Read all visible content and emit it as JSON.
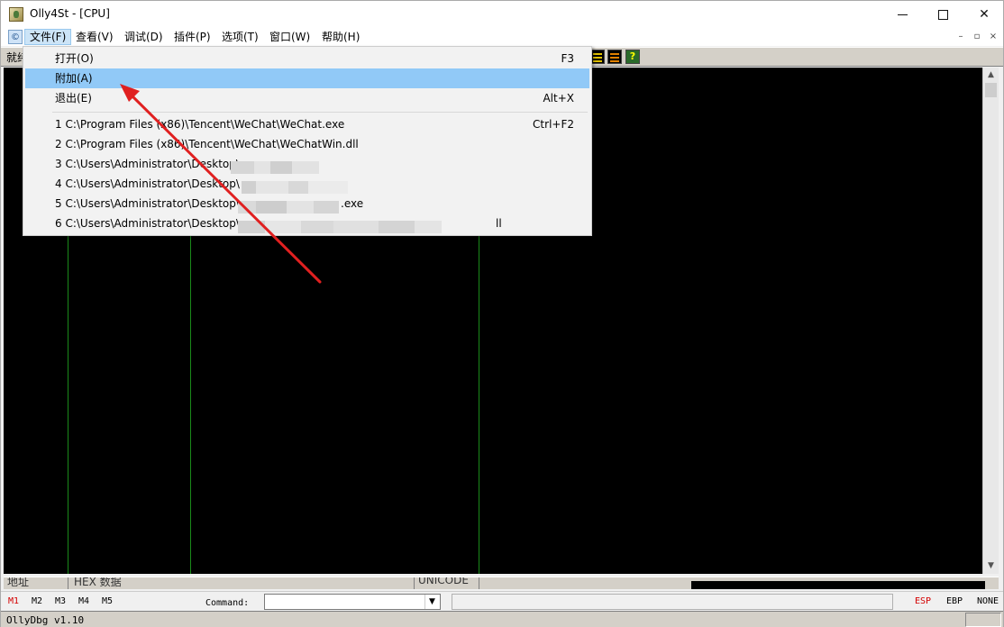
{
  "window": {
    "title": "Olly4St - [CPU]"
  },
  "menubar": {
    "items": [
      "文件(F)",
      "查看(V)",
      "调试(D)",
      "插件(P)",
      "选项(T)",
      "窗口(W)",
      "帮助(H)"
    ],
    "mdi_icon_glyph": "©",
    "mdi_controls": [
      "–",
      "▫",
      "×"
    ]
  },
  "toolbar": {
    "status_text": "就绪"
  },
  "dropdown": {
    "items": [
      {
        "label": "打开(O)",
        "shortcut": "F3"
      },
      {
        "label": "附加(A)",
        "shortcut": ""
      },
      {
        "label": "退出(E)",
        "shortcut": "Alt+X"
      }
    ],
    "recent": [
      {
        "label": "1 C:\\Program Files (x86)\\Tencent\\WeChat\\WeChat.exe",
        "shortcut": "Ctrl+F2"
      },
      {
        "label": "2 C:\\Program Files (x86)\\Tencent\\WeChat\\WeChatWin.dll",
        "shortcut": ""
      },
      {
        "label": "3 C:\\Users\\Administrator\\Desktop\\",
        "suffix": "",
        "shortcut": ""
      },
      {
        "label": "4 C:\\Users\\Administrator\\Desktop\\",
        "suffix": "",
        "shortcut": ""
      },
      {
        "label": "5 C:\\Users\\Administrator\\Desktop\\",
        "suffix": ".exe",
        "shortcut": ""
      },
      {
        "label": "6 C:\\Users\\Administrator\\Desktop\\",
        "suffix": "ll",
        "shortcut": ""
      }
    ]
  },
  "dump_header": {
    "col1": "地址",
    "col2": "HEX 数据",
    "col3": "UNICODE"
  },
  "command_bar": {
    "markers": [
      "M1",
      "M2",
      "M3",
      "M4",
      "M5"
    ],
    "label": "Command:",
    "value": "",
    "registers": [
      "ESP",
      "EBP",
      "NONE"
    ]
  },
  "statusbar": {
    "version": "OllyDbg v1.10"
  },
  "colors": {
    "highlight": "#91c9f7",
    "annotation_arrow": "#e02020",
    "grid_line": "#1a8a1a"
  }
}
